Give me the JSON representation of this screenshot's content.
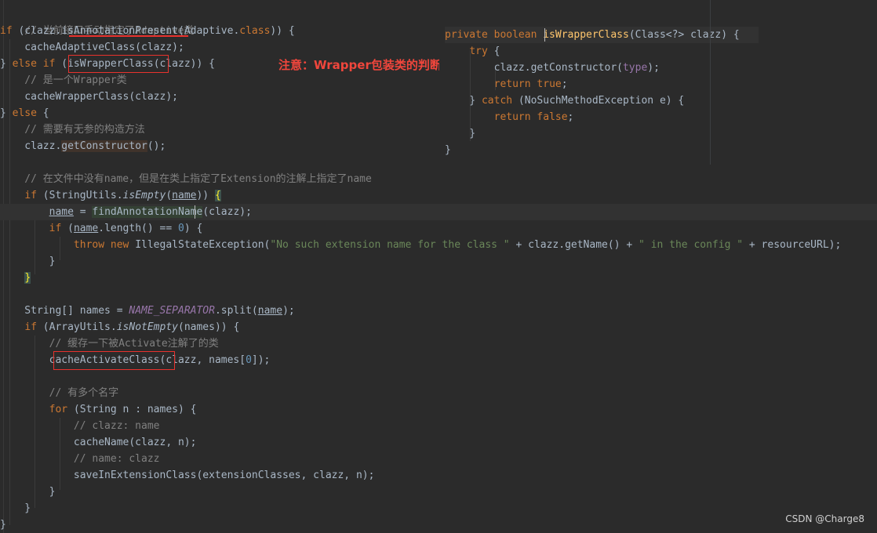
{
  "code_lines": [
    {
      "parts": [
        "// 当前接口手动指定了Adaptive类"
      ]
    },
    {
      "parts": [
        "if",
        " (clazz.",
        "isAnnotationPresent",
        "(Adaptive.",
        "class",
        ")) {"
      ]
    },
    {
      "parts": [
        "    cacheAdaptiveClass(clazz);"
      ]
    },
    {
      "parts": [
        "} ",
        "else if",
        " (",
        "isWrapperClass",
        "(clazz)) {"
      ]
    },
    {
      "parts": [
        "    // 是一个Wrapper类"
      ]
    },
    {
      "parts": [
        "    cacheWrapperClass(clazz);"
      ]
    },
    {
      "parts": [
        "} ",
        "else",
        " {"
      ]
    },
    {
      "parts": [
        "    // 需要有无参的构造方法"
      ]
    },
    {
      "parts": [
        "    clazz.",
        "getConstructor",
        "();"
      ]
    },
    {
      "parts": [
        ""
      ]
    },
    {
      "parts": [
        "    // 在文件中没有name，但是在类上指定了Extension的注解上指定了name"
      ]
    },
    {
      "parts": [
        "    ",
        "if",
        " (StringUtils.",
        "isEmpty",
        "(",
        "name",
        ")) ",
        "{"
      ]
    },
    {
      "parts": [
        "        ",
        "name",
        " = ",
        "findAnnotationName",
        "(clazz);"
      ]
    },
    {
      "parts": [
        "        ",
        "if",
        " (",
        "name",
        ".length() == ",
        "0",
        ") {"
      ]
    },
    {
      "parts": [
        "            ",
        "throw new",
        " IllegalStateException(",
        "\"No such extension name for the class \"",
        " + clazz.getName() + ",
        "\" in the config \"",
        " + resourceURL);"
      ]
    },
    {
      "parts": [
        "        }"
      ]
    },
    {
      "parts": [
        "    ",
        "}"
      ]
    },
    {
      "parts": [
        ""
      ]
    },
    {
      "parts": [
        "    String[] names = ",
        "NAME_SEPARATOR",
        ".split(",
        "name",
        ");"
      ]
    },
    {
      "parts": [
        "    ",
        "if",
        " (ArrayUtils.",
        "isNotEmpty",
        "(names)) {"
      ]
    },
    {
      "parts": [
        "        // 缓存一下被Activate注解了的类"
      ]
    },
    {
      "parts": [
        "        cacheActivateClass",
        "(clazz, names[",
        "0",
        "]);"
      ]
    },
    {
      "parts": [
        ""
      ]
    },
    {
      "parts": [
        "        // 有多个名字"
      ]
    },
    {
      "parts": [
        "        ",
        "for",
        " (String n : names) {"
      ]
    },
    {
      "parts": [
        "            // clazz: name"
      ]
    },
    {
      "parts": [
        "            cacheName(clazz, n);"
      ]
    },
    {
      "parts": [
        "            // name: clazz"
      ]
    },
    {
      "parts": [
        "            saveInExtensionClass(extensionClasses, clazz, n);"
      ]
    },
    {
      "parts": [
        "        }"
      ]
    },
    {
      "parts": [
        "    }"
      ]
    },
    {
      "parts": [
        "}"
      ]
    }
  ],
  "popup_lines": [
    {
      "parts": [
        "private boolean ",
        "isWrapperClass",
        "(Class<?> clazz) {"
      ]
    },
    {
      "parts": [
        "    ",
        "try",
        " {"
      ]
    },
    {
      "parts": [
        "        clazz.getConstructor(",
        "type",
        ");"
      ]
    },
    {
      "parts": [
        "        ",
        "return true",
        ";"
      ]
    },
    {
      "parts": [
        "    } ",
        "catch",
        " (NoSuchMethodException e) {"
      ]
    },
    {
      "parts": [
        "        ",
        "return false",
        ";"
      ]
    },
    {
      "parts": [
        "    }"
      ]
    },
    {
      "parts": [
        "}"
      ]
    }
  ],
  "annotation_note": "注意：Wrapper包装类的判断",
  "watermark": "CSDN @Charge8",
  "colors": {
    "background": "#2b2b2b",
    "keyword": "#cc7832",
    "comment": "#808080",
    "string": "#6a8759",
    "number": "#6897bb",
    "static_field": "#9876aa",
    "highlight_box": "#e8322d"
  }
}
